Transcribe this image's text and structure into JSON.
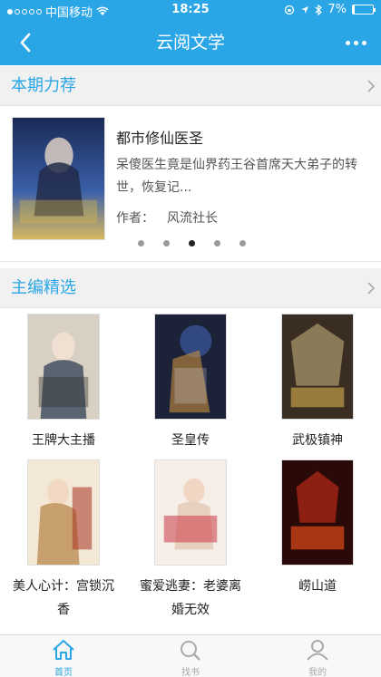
{
  "status_bar": {
    "carrier": "中国移动",
    "time": "18:25",
    "battery": "7%",
    "battery_level": 0.07
  },
  "nav": {
    "title": "云阅文学"
  },
  "recommend": {
    "heading": "本期力荐",
    "book": {
      "title": "都市修仙医圣",
      "description": "呆傻医生竟是仙界药王谷首席天大弟子的转世，恢复记...",
      "author_label": "作者：",
      "author": "风流社长"
    },
    "pager": {
      "pages": 5,
      "active_index": 2
    }
  },
  "editor_picks": {
    "heading": "主编精选",
    "books": [
      {
        "name": "王牌大主播"
      },
      {
        "name": "圣皇传"
      },
      {
        "name": "武极镇神"
      },
      {
        "name": "美人心计：宫锁沉香"
      },
      {
        "name": "蜜爱逃妻：老婆离婚无效"
      },
      {
        "name": "崂山道"
      }
    ]
  },
  "tabbar": {
    "tabs": [
      {
        "label": "首页",
        "icon": "home-icon",
        "active": true
      },
      {
        "label": "找书",
        "icon": "search-icon",
        "active": false
      },
      {
        "label": "我的",
        "icon": "user-icon",
        "active": false
      }
    ]
  },
  "colors": {
    "accent": "#2aa6e6",
    "section_bg": "#f1f1f1"
  }
}
